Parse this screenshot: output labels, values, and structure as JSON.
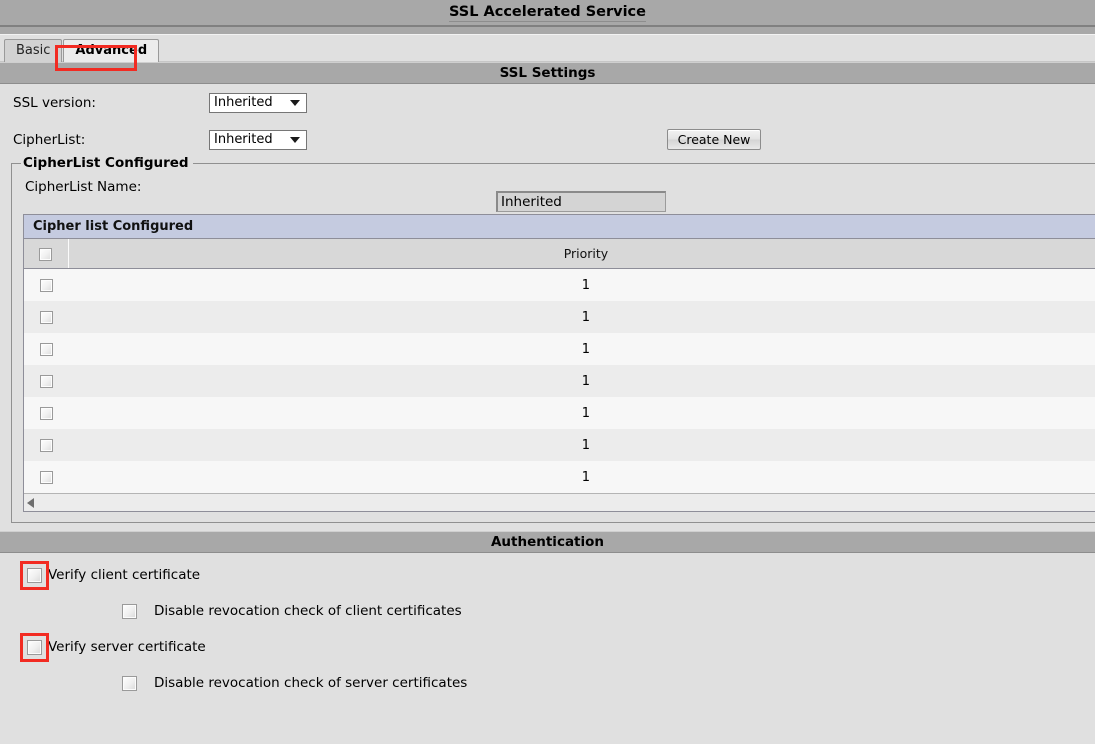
{
  "window": {
    "title": "SSL Accelerated Service"
  },
  "tabs": [
    {
      "label": "Basic",
      "active": false
    },
    {
      "label": "Advanced",
      "active": true
    }
  ],
  "sections": {
    "ssl_settings": {
      "title": "SSL Settings"
    },
    "authentication": {
      "title": "Authentication"
    }
  },
  "ssl_settings": {
    "ssl_version": {
      "label": "SSL version:",
      "value": "Inherited"
    },
    "cipher_list": {
      "label": "CipherList:",
      "value": "Inherited"
    },
    "create_new_button": "Create New"
  },
  "cipherlist_configured": {
    "legend": "CipherList Configured",
    "name_label": "CipherList Name:",
    "name_value": "Inherited",
    "table": {
      "caption": "Cipher list Configured",
      "columns": [
        "",
        "Priority",
        ""
      ],
      "rows": [
        {
          "checked": false,
          "priority": "1"
        },
        {
          "checked": false,
          "priority": "1"
        },
        {
          "checked": false,
          "priority": "1"
        },
        {
          "checked": false,
          "priority": "1"
        },
        {
          "checked": false,
          "priority": "1"
        },
        {
          "checked": false,
          "priority": "1"
        },
        {
          "checked": false,
          "priority": "1"
        }
      ]
    }
  },
  "authentication": {
    "verify_client_certificate": {
      "label": "Verify client certificate",
      "checked": false,
      "highlighted": true
    },
    "disable_revocation_client": {
      "label": "Disable revocation check of client certificates",
      "checked": false,
      "highlighted": false
    },
    "verify_server_certificate": {
      "label": "Verify server certificate",
      "checked": false,
      "highlighted": true
    },
    "disable_revocation_server": {
      "label": "Disable revocation check of server certificates",
      "checked": false,
      "highlighted": false
    }
  },
  "colors": {
    "header_bar": "#a8a8a8",
    "page_background": "#e0e0e0",
    "table_caption": "#c5cbe0",
    "annotation": "#f22b22"
  }
}
